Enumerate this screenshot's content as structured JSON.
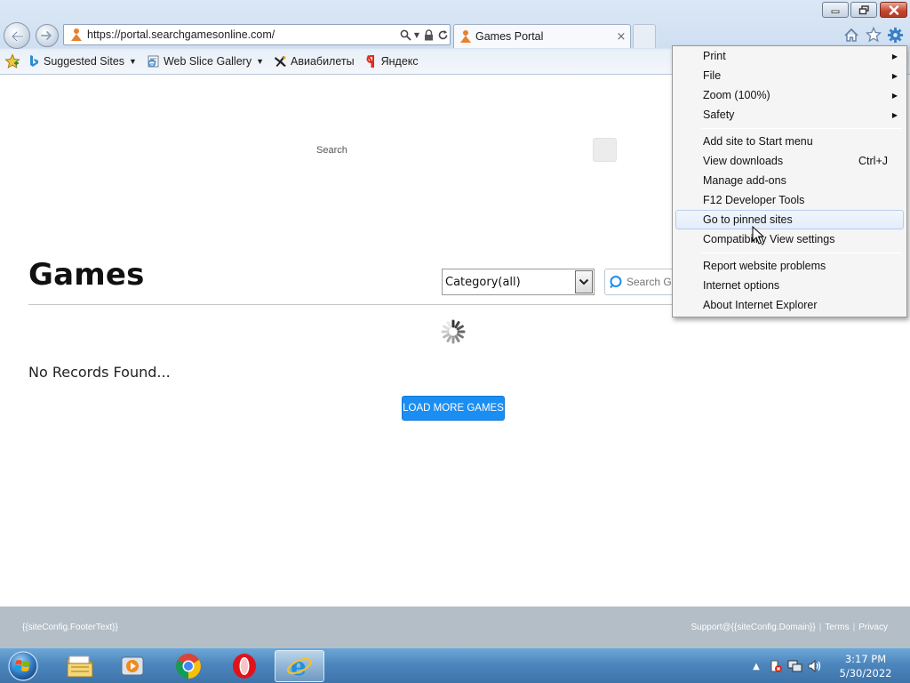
{
  "browser": {
    "url": "https://portal.searchgamesonline.com/",
    "tab_title": "Games Portal",
    "tab_close": "×",
    "favorites": [
      {
        "label": "Suggested Sites",
        "icon": "bing-icon",
        "dropdown": true
      },
      {
        "label": "Web Slice Gallery",
        "icon": "web-slice-icon",
        "dropdown": true
      },
      {
        "label": "Авиабилеты",
        "icon": "plane-icon",
        "dropdown": false
      },
      {
        "label": "Яндекс",
        "icon": "yandex-icon",
        "dropdown": false
      }
    ]
  },
  "page": {
    "search_label": "Search",
    "title": "Games",
    "category_value": "Category(all)",
    "search_placeholder": "Search Games",
    "no_records": "No Records Found...",
    "load_more": "LOAD MORE GAMES"
  },
  "footer": {
    "left_text": "{{siteConfig.FooterText}}",
    "support": "Support@{{siteConfig.Domain}}",
    "separator": "|",
    "terms": "Terms",
    "privacy": "Privacy"
  },
  "tools_menu": {
    "items": [
      {
        "label": "Print",
        "submenu": true
      },
      {
        "label": "File",
        "submenu": true
      },
      {
        "label": "Zoom (100%)",
        "submenu": true
      },
      {
        "label": "Safety",
        "submenu": true
      },
      {
        "label": "Add site to Start menu"
      },
      {
        "label": "View downloads",
        "shortcut": "Ctrl+J"
      },
      {
        "label": "Manage add-ons"
      },
      {
        "label": "F12 Developer Tools"
      },
      {
        "label": "Go to pinned sites",
        "highlighted": true
      },
      {
        "label": "Compatibility View settings"
      },
      {
        "label": "Report website problems"
      },
      {
        "label": "Internet options"
      },
      {
        "label": "About Internet Explorer"
      }
    ]
  },
  "taskbar": {
    "apps": [
      "file-explorer-icon",
      "media-player-icon",
      "chrome-icon",
      "opera-icon",
      "internet-explorer-icon"
    ],
    "active_app": "internet-explorer-icon",
    "time": "3:17 PM",
    "date": "5/30/2022"
  },
  "colors": {
    "accent_button": "#1a8ef2",
    "footer_bg": "#b3bec7",
    "taskbar": "#4c86bd"
  }
}
